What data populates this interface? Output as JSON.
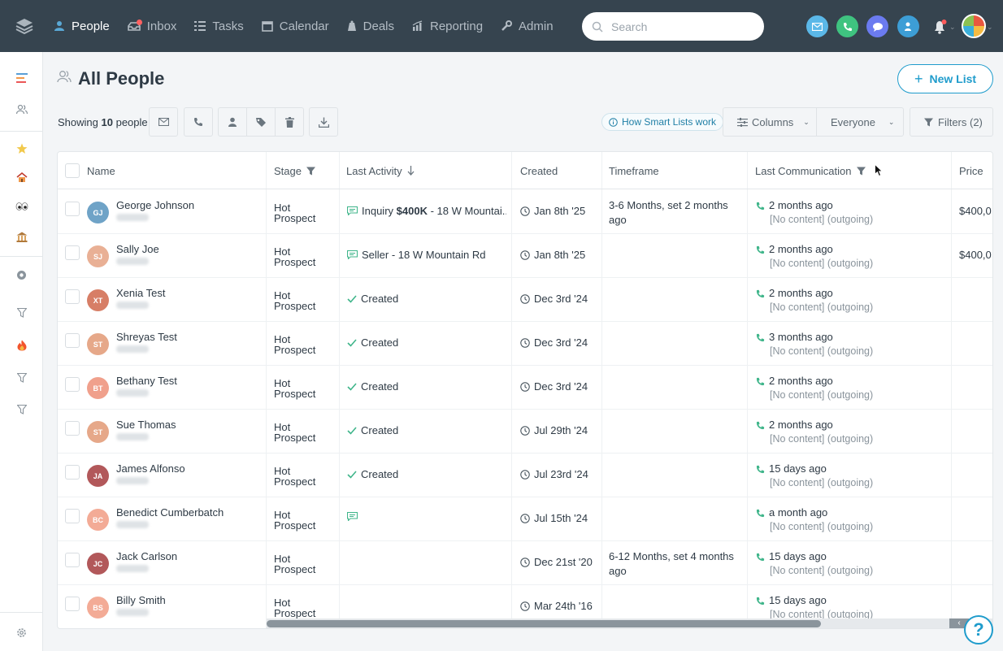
{
  "nav": {
    "items": [
      {
        "label": "People",
        "active": true
      },
      {
        "label": "Inbox"
      },
      {
        "label": "Tasks"
      },
      {
        "label": "Calendar"
      },
      {
        "label": "Deals"
      },
      {
        "label": "Reporting"
      },
      {
        "label": "Admin"
      }
    ],
    "search_placeholder": "Search"
  },
  "page": {
    "title": "All People",
    "new_list": "New List",
    "showing_prefix": "Showing",
    "showing_count": "10",
    "showing_suffix": "people",
    "smart_lists": "How Smart Lists work",
    "columns": "Columns",
    "everyone": "Everyone",
    "filters": "Filters (2)"
  },
  "table": {
    "headers": [
      "Name",
      "Stage",
      "Last Activity",
      "Created",
      "Timeframe",
      "Last Communication",
      "Price"
    ],
    "rows": [
      {
        "initials": "GJ",
        "color": "#6fa3c7",
        "name": "George Johnson",
        "stage": "Hot Prospect",
        "activity_type": "message",
        "activity_pre": "Inquiry",
        "activity_bold": "$400K",
        "activity_post": "- 18 W Mountai...",
        "created": "Jan 8th '25",
        "timeframe": "3-6 Months, set 2 months ago",
        "comm": "2 months ago",
        "comm_sub": "[No content] (outgoing)",
        "price": "$400,0"
      },
      {
        "initials": "SJ",
        "color": "#e9b095",
        "name": "Sally Joe",
        "stage": "Hot Prospect",
        "activity_type": "message",
        "activity_pre": "Seller - 18 W Mountain Rd",
        "activity_bold": "",
        "activity_post": "",
        "created": "Jan 8th '25",
        "timeframe": "",
        "comm": "2 months ago",
        "comm_sub": "[No content] (outgoing)",
        "price": "$400,0"
      },
      {
        "initials": "XT",
        "color": "#d77e66",
        "name": "Xenia Test",
        "stage": "Hot Prospect",
        "activity_type": "check",
        "activity_pre": "Created",
        "activity_bold": "",
        "activity_post": "",
        "created": "Dec 3rd '24",
        "timeframe": "",
        "comm": "2 months ago",
        "comm_sub": "[No content] (outgoing)",
        "price": ""
      },
      {
        "initials": "ST",
        "color": "#e6a889",
        "name": "Shreyas Test",
        "stage": "Hot Prospect",
        "activity_type": "check",
        "activity_pre": "Created",
        "activity_bold": "",
        "activity_post": "",
        "created": "Dec 3rd '24",
        "timeframe": "",
        "comm": "3 months ago",
        "comm_sub": "[No content] (outgoing)",
        "price": ""
      },
      {
        "initials": "BT",
        "color": "#f0a08c",
        "name": "Bethany Test",
        "stage": "Hot Prospect",
        "activity_type": "check",
        "activity_pre": "Created",
        "activity_bold": "",
        "activity_post": "",
        "created": "Dec 3rd '24",
        "timeframe": "",
        "comm": "2 months ago",
        "comm_sub": "[No content] (outgoing)",
        "price": ""
      },
      {
        "initials": "ST",
        "color": "#e6a889",
        "name": "Sue Thomas",
        "stage": "Hot Prospect",
        "activity_type": "check",
        "activity_pre": "Created",
        "activity_bold": "",
        "activity_post": "",
        "created": "Jul 29th '24",
        "timeframe": "",
        "comm": "2 months ago",
        "comm_sub": "[No content] (outgoing)",
        "price": ""
      },
      {
        "initials": "JA",
        "color": "#b2585a",
        "name": "James Alfonso",
        "stage": "Hot Prospect",
        "activity_type": "check",
        "activity_pre": "Created",
        "activity_bold": "",
        "activity_post": "",
        "created": "Jul 23rd '24",
        "timeframe": "",
        "comm": "15 days ago",
        "comm_sub": "[No content] (outgoing)",
        "price": ""
      },
      {
        "initials": "BC",
        "color": "#f3ab96",
        "name": "Benedict Cumberbatch",
        "stage": "Hot Prospect",
        "activity_type": "message",
        "activity_pre": "",
        "activity_bold": "",
        "activity_post": "",
        "created": "Jul 15th '24",
        "timeframe": "",
        "comm": "a month ago",
        "comm_sub": "[No content] (outgoing)",
        "price": ""
      },
      {
        "initials": "JC",
        "color": "#b2585a",
        "name": "Jack Carlson",
        "stage": "Hot Prospect",
        "activity_type": "none",
        "activity_pre": "",
        "activity_bold": "",
        "activity_post": "",
        "created": "Dec 21st '20",
        "timeframe": "6-12 Months, set 4 months ago",
        "comm": "15 days ago",
        "comm_sub": "[No content] (outgoing)",
        "price": ""
      },
      {
        "initials": "BS",
        "color": "#f3ab96",
        "name": "Billy Smith",
        "stage": "Hot Prospect",
        "activity_type": "none",
        "activity_pre": "",
        "activity_bold": "",
        "activity_post": "",
        "created": "Mar 24th '16",
        "timeframe": "",
        "comm": "15 days ago",
        "comm_sub": "[No content] (outgoing)",
        "price": ""
      }
    ]
  },
  "help": "?"
}
